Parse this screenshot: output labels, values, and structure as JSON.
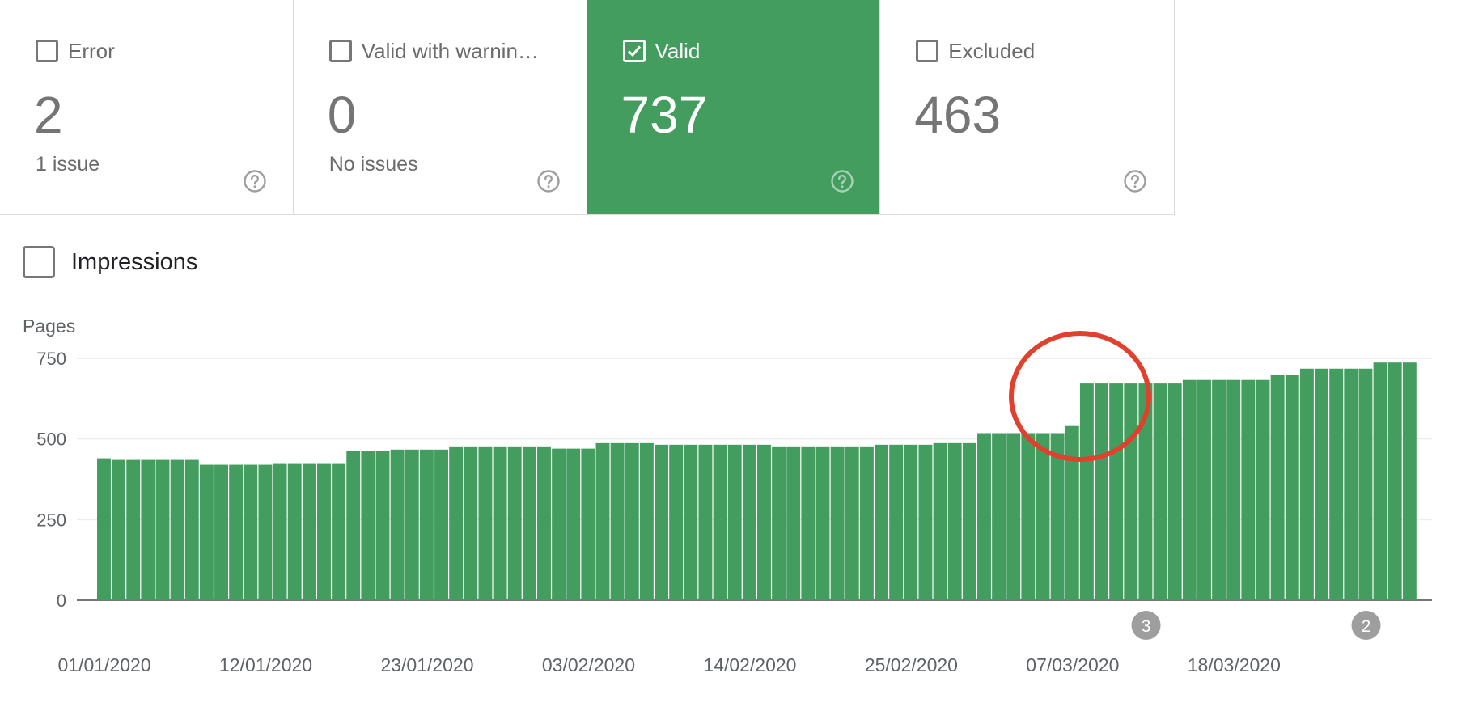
{
  "cards": [
    {
      "label": "Error",
      "value": "2",
      "sub": "1 issue",
      "checked": false,
      "active": false
    },
    {
      "label": "Valid with warnin…",
      "value": "0",
      "sub": "No issues",
      "checked": false,
      "active": false
    },
    {
      "label": "Valid",
      "value": "737",
      "sub": "",
      "checked": true,
      "active": true
    },
    {
      "label": "Excluded",
      "value": "463",
      "sub": "",
      "checked": false,
      "active": false
    }
  ],
  "impressions": {
    "label": "Impressions",
    "checked": false
  },
  "colors": {
    "accent": "#439d5f",
    "bar": "#439d5f",
    "annotation_circle": "#e0412e"
  },
  "chart_data": {
    "type": "bar",
    "ylabel": "Pages",
    "ylim": [
      0,
      750
    ],
    "yticks": [
      0,
      250,
      500,
      750
    ],
    "xticks": [
      "01/01/2020",
      "12/01/2020",
      "23/01/2020",
      "03/02/2020",
      "14/02/2020",
      "25/02/2020",
      "07/03/2020",
      "18/03/2020"
    ],
    "series": [
      {
        "values": [
          440,
          435,
          435,
          435,
          435,
          435,
          435,
          420,
          420,
          420,
          420,
          420,
          425,
          425,
          425,
          425,
          425,
          462,
          462,
          462,
          467,
          467,
          467,
          467,
          477,
          477,
          477,
          477,
          477,
          477,
          477,
          470,
          470,
          470,
          487,
          487,
          487,
          487,
          482,
          482,
          482,
          482,
          482,
          482,
          482,
          482,
          477,
          477,
          477,
          477,
          477,
          477,
          477,
          482,
          482,
          482,
          482,
          487,
          487,
          487,
          518,
          518,
          518,
          518,
          518,
          518,
          540,
          672,
          672,
          672,
          672,
          672,
          672,
          672,
          683,
          683,
          683,
          683,
          683,
          683,
          698,
          698,
          718,
          718,
          718,
          718,
          718,
          737,
          737,
          737
        ]
      }
    ],
    "annotations": [
      {
        "date": "12/03/2020",
        "label": "3"
      },
      {
        "date": "27/03/2020",
        "label": "2"
      }
    ],
    "highlight": {
      "date": "08/03/2020",
      "shape": "circle"
    },
    "grid": true
  }
}
